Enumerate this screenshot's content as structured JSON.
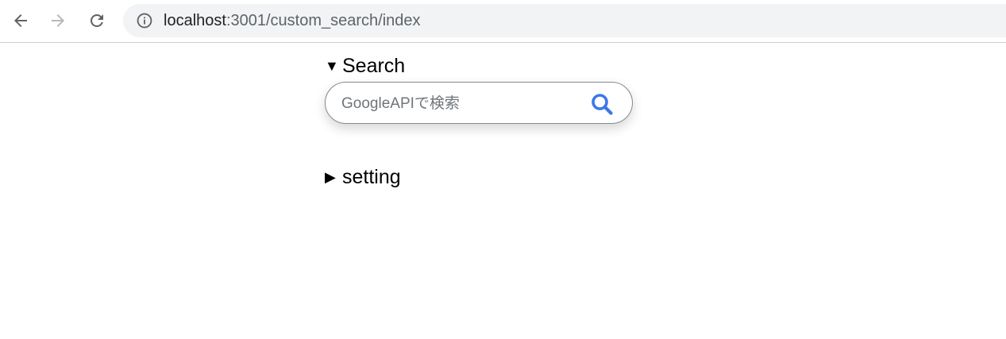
{
  "browser": {
    "url_host": "localhost",
    "url_rest": ":3001/custom_search/index",
    "icons": {
      "back": "arrow-left-icon",
      "forward": "arrow-right-icon",
      "reload": "reload-icon",
      "info": "info-icon"
    }
  },
  "search_section": {
    "marker": "▼",
    "label": "Search",
    "input": {
      "placeholder": "GoogleAPIで検索",
      "value": ""
    },
    "button_icon": "search-icon",
    "accent_color": "#3b78e7"
  },
  "setting_section": {
    "marker": "▶",
    "label": "setting"
  }
}
